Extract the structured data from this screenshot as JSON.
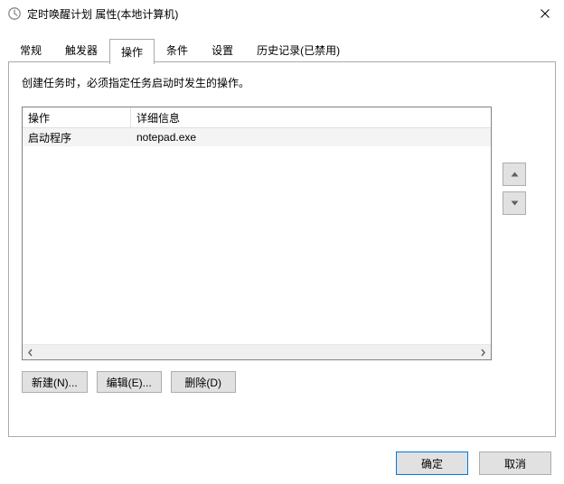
{
  "window": {
    "title": "定时唤醒计划 属性(本地计算机)"
  },
  "tabs": {
    "items": [
      {
        "label": "常规"
      },
      {
        "label": "触发器"
      },
      {
        "label": "操作"
      },
      {
        "label": "条件"
      },
      {
        "label": "设置"
      },
      {
        "label": "历史记录(已禁用)"
      }
    ],
    "active_index": 2
  },
  "actions_page": {
    "description": "创建任务时，必须指定任务启动时发生的操作。",
    "columns": {
      "action": "操作",
      "details": "详细信息"
    },
    "rows": [
      {
        "action": "启动程序",
        "details": "notepad.exe"
      }
    ],
    "buttons": {
      "new": "新建(N)...",
      "edit": "编辑(E)...",
      "delete": "删除(D)"
    },
    "move": {
      "up": "▲",
      "down": "▼"
    }
  },
  "dialog": {
    "ok": "确定",
    "cancel": "取消"
  }
}
